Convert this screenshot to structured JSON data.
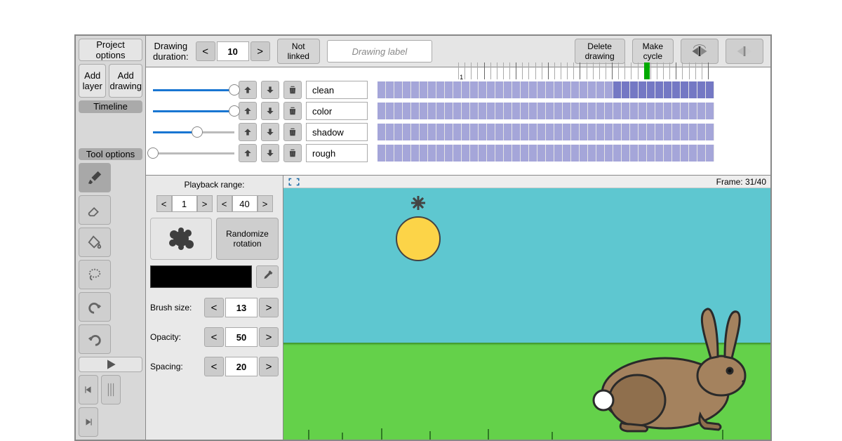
{
  "sidebar": {
    "project_options": "Project\noptions",
    "add_layer": "Add\nlayer",
    "add_drawing": "Add\ndrawing",
    "timeline": "Timeline",
    "tool_options": "Tool options"
  },
  "topbar": {
    "duration_label": "Drawing\nduration:",
    "duration_value": "10",
    "not_linked": "Not\nlinked",
    "label_placeholder": "Drawing label",
    "delete_drawing": "Delete\ndrawing",
    "make_cycle": "Make\ncycle",
    "playhead_tick": 30
  },
  "layers": [
    {
      "name": "clean",
      "slider": 100,
      "selected_from": 29,
      "selected_to": 40
    },
    {
      "name": "color",
      "slider": 100,
      "selected_from": -1,
      "selected_to": -1
    },
    {
      "name": "shadow",
      "slider": 54,
      "selected_from": -1,
      "selected_to": -1
    },
    {
      "name": "rough",
      "slider": 0,
      "selected_from": -1,
      "selected_to": -1
    }
  ],
  "playback": {
    "label": "Playback range:",
    "start": "1",
    "end": "40"
  },
  "brush": {
    "randomize": "Randomize\nrotation",
    "size_label": "Brush size:",
    "size_value": "13",
    "opacity_label": "Opacity:",
    "opacity_value": "50",
    "spacing_label": "Spacing:",
    "spacing_value": "20"
  },
  "canvas": {
    "frame_label": "Frame: 31/40"
  }
}
